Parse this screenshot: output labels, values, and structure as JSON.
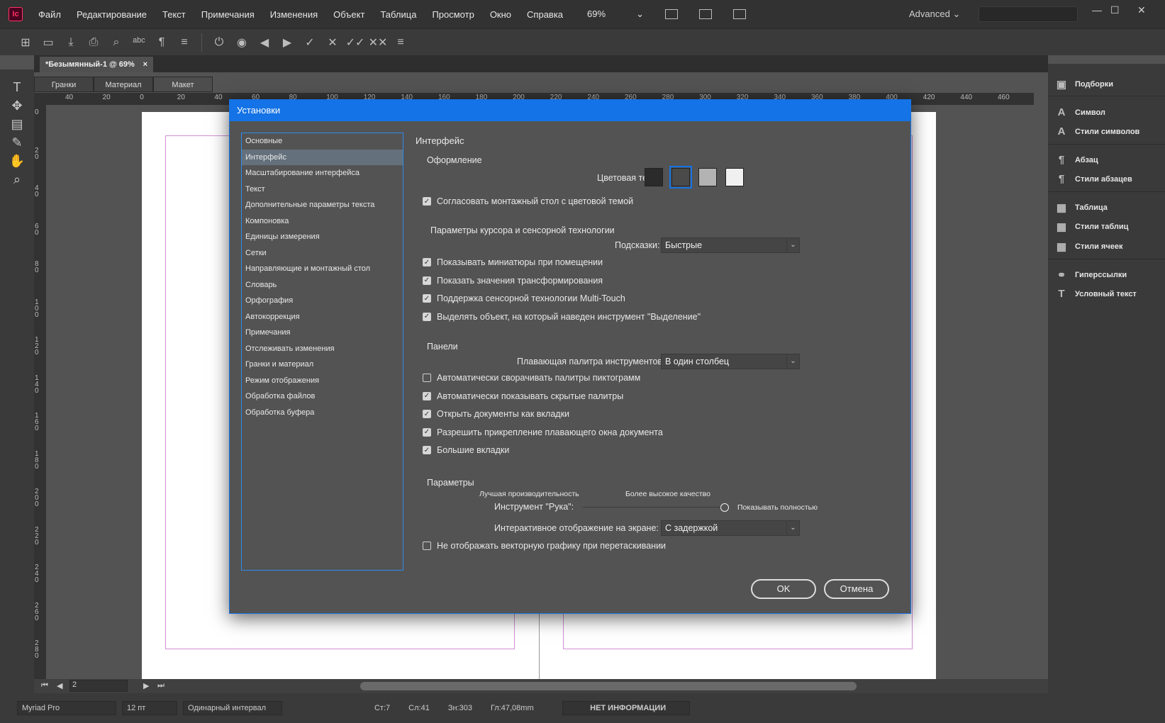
{
  "menubar": {
    "logo": "Ic",
    "items": [
      "Файл",
      "Редактирование",
      "Текст",
      "Примечания",
      "Изменения",
      "Объект",
      "Таблица",
      "Просмотр",
      "Окно",
      "Справка"
    ],
    "zoom": "69%",
    "workspace": "Advanced"
  },
  "document_tab": {
    "title": "*Безымянный-1 @ 69%",
    "close": "×"
  },
  "mode_tabs": [
    "Гранки",
    "Материал",
    "Макет"
  ],
  "ruler": {
    "h_ticks": [
      "40",
      "20",
      "0",
      "20",
      "40",
      "60",
      "80",
      "100",
      "120",
      "140",
      "160",
      "180",
      "200",
      "220",
      "240",
      "260",
      "280",
      "300",
      "320",
      "340",
      "360",
      "380",
      "400",
      "420",
      "440",
      "460"
    ],
    "v_ticks": [
      "0",
      "20",
      "40",
      "60",
      "80",
      "100",
      "120",
      "140",
      "160",
      "180",
      "200",
      "220",
      "240",
      "260",
      "280"
    ]
  },
  "right_panel": {
    "items": [
      {
        "label": "Подборки",
        "icon": "library-icon"
      },
      {
        "label": "Символ",
        "icon": "character-icon"
      },
      {
        "label": "Стили символов",
        "icon": "character-styles-icon"
      },
      {
        "label": "Абзац",
        "icon": "paragraph-icon"
      },
      {
        "label": "Стили абзацев",
        "icon": "paragraph-styles-icon"
      },
      {
        "label": "Таблица",
        "icon": "table-icon"
      },
      {
        "label": "Стили таблиц",
        "icon": "table-styles-icon"
      },
      {
        "label": "Стили ячеек",
        "icon": "cell-styles-icon"
      },
      {
        "label": "Гиперссылки",
        "icon": "hyperlinks-icon"
      },
      {
        "label": "Условный текст",
        "icon": "conditional-text-icon"
      }
    ]
  },
  "navbar": {
    "page": "2"
  },
  "statusbar": {
    "font": "Myriad Pro",
    "size": "12 пт",
    "spacing": "Одинарный интервал",
    "lines": "Ст:7",
    "words": "Сл:41",
    "chars": "Зн:303",
    "depth": "Гл:47,08mm",
    "info": "НЕТ ИНФОРМАЦИИ"
  },
  "dialog": {
    "title": "Установки",
    "categories": [
      "Основные",
      "Интерфейс",
      "Масштабирование интерфейса",
      "Текст",
      "Дополнительные параметры текста",
      "Компоновка",
      "Единицы измерения",
      "Сетки",
      "Направляющие и монтажный стол",
      "Словарь",
      "Орфография",
      "Автокоррекция",
      "Примечания",
      "Отслеживать изменения",
      "Гранки и материал",
      "Режим отображения",
      "Обработка файлов",
      "Обработка буфера"
    ],
    "selected_category": "Интерфейс",
    "heading": "Интерфейс",
    "appearance": {
      "section": "Оформление",
      "theme_label": "Цветовая тема:",
      "theme_colors": [
        "#2b2b2b",
        "#4a4a4a",
        "#b3b3b3",
        "#f0f0f0"
      ],
      "match_pasteboard": "Согласовать монтажный стол с цветовой темой"
    },
    "cursor": {
      "section": "Параметры курсора и сенсорной технологии",
      "tooltips_label": "Подсказки:",
      "tooltips_value": "Быстрые",
      "options": [
        {
          "label": "Показывать миниатюры при помещении",
          "checked": true
        },
        {
          "label": "Показать значения трансформирования",
          "checked": true
        },
        {
          "label": "Поддержка сенсорной технологии Multi-Touch",
          "checked": true
        },
        {
          "label": "Выделять объект, на который наведен инструмент \"Выделение\"",
          "checked": true
        }
      ]
    },
    "panels": {
      "section": "Панели",
      "floating_label": "Плавающая палитра инструментов:",
      "floating_value": "В один столбец",
      "options": [
        {
          "label": "Автоматически сворачивать палитры пиктограмм",
          "checked": false
        },
        {
          "label": "Автоматически показывать скрытые палитры",
          "checked": true
        },
        {
          "label": "Открыть документы как вкладки",
          "checked": true
        },
        {
          "label": "Разрешить прикрепление плавающего окна документа",
          "checked": true
        },
        {
          "label": "Большие вкладки",
          "checked": true
        }
      ]
    },
    "options": {
      "section": "Параметры",
      "slider_left": "Лучшая производительность",
      "slider_right": "Более высокое качество",
      "hand_label": "Инструмент \"Рука\":",
      "hand_value_text": "Показывать полностью",
      "hand_value": 1.0,
      "live_label": "Интерактивное отображение на экране:",
      "live_value": "С задержкой",
      "greek": {
        "label": "Не отображать векторную графику при перетаскивании",
        "checked": false
      }
    },
    "ok": "OK",
    "cancel": "Отмена"
  }
}
